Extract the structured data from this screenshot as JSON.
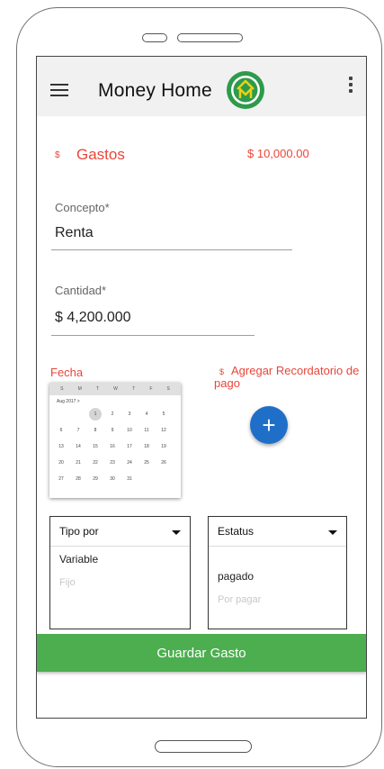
{
  "app": {
    "title": "Money Home"
  },
  "expenses": {
    "symbol": "$",
    "title": "Gastos",
    "total": "$ 10,000.00"
  },
  "form": {
    "concept_label": "Concepto*",
    "concept_value": "Renta",
    "amount_label": "Cantidad*",
    "amount_value": "$ 4,200.000",
    "date_label": "Fecha",
    "reminder_symbol": "$",
    "reminder_label": "Agregar Recordatorio de pago",
    "add_icon": "plus-icon"
  },
  "calendar": {
    "weekdays": [
      "S",
      "M",
      "T",
      "W",
      "T",
      "F",
      "S"
    ],
    "month": "Aug 2017 >",
    "days": [
      "1",
      "2",
      "3",
      "4",
      "5",
      "6",
      "7",
      "8",
      "9",
      "10",
      "11",
      "12",
      "13",
      "14",
      "15",
      "16",
      "17",
      "18",
      "19",
      "20",
      "21",
      "22",
      "23",
      "24",
      "25",
      "26",
      "27",
      "28",
      "29",
      "30",
      "31"
    ],
    "selected_day": "1",
    "first_weekday_index": 2
  },
  "type_dropdown": {
    "label": "Tipo por",
    "options": [
      "Variable",
      "Fijo"
    ]
  },
  "status_dropdown": {
    "label": "Estatus",
    "options": [
      "pagado",
      "Por pagar"
    ]
  },
  "save_button": {
    "label": "Guardar Gasto"
  },
  "colors": {
    "accent_red": "#e8463a",
    "fab_blue": "#1f6fc8",
    "save_green": "#4cae4f",
    "logo_green": "#2e9a4b",
    "logo_yellow": "#e8d21a"
  }
}
